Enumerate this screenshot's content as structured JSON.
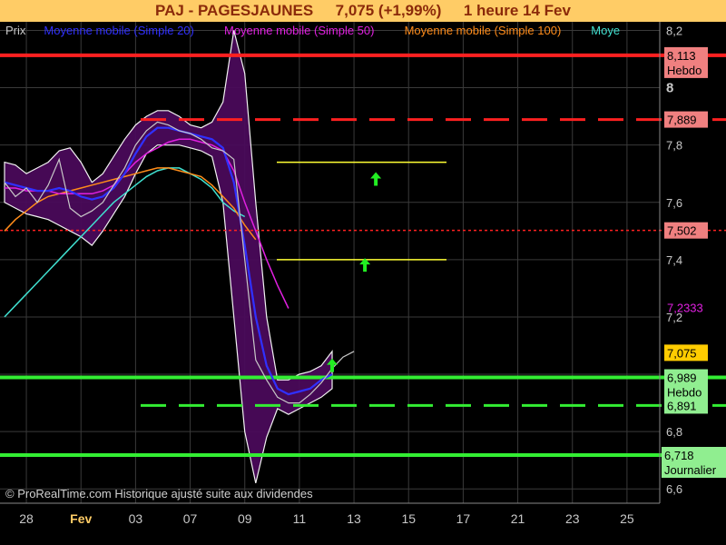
{
  "header": {
    "symbol": "PAJ - PAGESJAUNES",
    "quote": "7,075 (+1,99%)",
    "period": "1 heure  14 Fev"
  },
  "legend": [
    {
      "label": "Prix",
      "color": "#c8c8c8"
    },
    {
      "label": "Moyenne mobile (Simple 20)",
      "color": "#3030ff"
    },
    {
      "label": "Moyenne mobile (Simple 50)",
      "color": "#e020e0"
    },
    {
      "label": "Moyenne mobile (Simple 100)",
      "color": "#ff8c1a"
    },
    {
      "label": "Moye",
      "color": "#40e0d0"
    }
  ],
  "footer": "© ProRealTime.com Historique ajusté suite aux dividendes",
  "chart_data": {
    "type": "line",
    "ylim": [
      6.55,
      8.23
    ],
    "y_ticks": [
      {
        "v": 8.2,
        "label": "8,2"
      },
      {
        "v": 8.0,
        "label": "8"
      },
      {
        "v": 7.8,
        "label": "7,8"
      },
      {
        "v": 7.6,
        "label": "7,6"
      },
      {
        "v": 7.4,
        "label": "7,4"
      },
      {
        "v": 7.2,
        "label": "7,2"
      },
      {
        "v": 7.0,
        "label": "7"
      },
      {
        "v": 6.8,
        "label": "6,8"
      },
      {
        "v": 6.6,
        "label": "6,6"
      }
    ],
    "x_ticks": [
      "28",
      "Fev",
      "03",
      "07",
      "09",
      "11",
      "13",
      "15",
      "17",
      "21",
      "23",
      "25"
    ],
    "x_tick_index": [
      2,
      7,
      12,
      17,
      22,
      27,
      32,
      37,
      42,
      47,
      52,
      57
    ],
    "x_count": 60,
    "series": [
      {
        "name": "Prix",
        "color": "#c8c8c8",
        "values": [
          7.67,
          7.62,
          7.65,
          7.6,
          7.66,
          7.75,
          7.58,
          7.55,
          7.57,
          7.6,
          7.66,
          7.72,
          7.8,
          7.85,
          7.88,
          7.87,
          7.85,
          7.84,
          7.82,
          7.79,
          7.78,
          7.75,
          7.4,
          7.05,
          6.98,
          6.92,
          6.9,
          6.9,
          6.93,
          6.97,
          7.02,
          7.06,
          7.08
        ]
      },
      {
        "name": "Moyenne mobile (Simple 20)",
        "color": "#3030ff",
        "values": [
          7.67,
          7.66,
          7.65,
          7.64,
          7.64,
          7.65,
          7.64,
          7.62,
          7.61,
          7.62,
          7.65,
          7.7,
          7.77,
          7.83,
          7.86,
          7.86,
          7.85,
          7.84,
          7.83,
          7.82,
          7.79,
          7.67,
          7.45,
          7.2,
          7.03,
          6.95,
          6.93,
          6.94,
          6.95,
          6.98,
          7.0
        ]
      },
      {
        "name": "Moyenne mobile (Simple 50)",
        "color": "#e020e0",
        "values": [
          7.65,
          7.65,
          7.64,
          7.64,
          7.64,
          7.63,
          7.63,
          7.63,
          7.63,
          7.64,
          7.66,
          7.7,
          7.74,
          7.77,
          7.79,
          7.81,
          7.82,
          7.82,
          7.81,
          7.8,
          7.78,
          7.71,
          7.6,
          7.5,
          7.4,
          7.31,
          7.23
        ]
      },
      {
        "name": "Moyenne mobile (Simple 100)",
        "color": "#ff8c1a",
        "values": [
          7.5,
          7.54,
          7.57,
          7.6,
          7.62,
          7.63,
          7.64,
          7.65,
          7.66,
          7.67,
          7.68,
          7.69,
          7.7,
          7.71,
          7.72,
          7.72,
          7.71,
          7.7,
          7.69,
          7.66,
          7.62,
          7.58,
          7.52,
          7.47
        ]
      },
      {
        "name": "Moye",
        "color": "#40e0d0",
        "values": [
          7.2,
          7.24,
          7.28,
          7.32,
          7.36,
          7.4,
          7.44,
          7.48,
          7.52,
          7.56,
          7.6,
          7.63,
          7.66,
          7.69,
          7.71,
          7.72,
          7.72,
          7.7,
          7.68,
          7.65,
          7.6,
          7.57,
          7.55
        ]
      }
    ],
    "bollinger_upper": [
      7.74,
      7.73,
      7.7,
      7.72,
      7.74,
      7.78,
      7.79,
      7.74,
      7.67,
      7.7,
      7.76,
      7.82,
      7.87,
      7.9,
      7.92,
      7.92,
      7.9,
      7.87,
      7.86,
      7.88,
      7.95,
      8.2,
      8.05,
      7.6,
      7.2,
      6.98,
      6.98,
      7.0,
      7.01,
      7.03,
      7.08
    ],
    "bollinger_lower": [
      7.6,
      7.58,
      7.56,
      7.55,
      7.54,
      7.52,
      7.5,
      7.48,
      7.45,
      7.5,
      7.56,
      7.62,
      7.7,
      7.77,
      7.8,
      7.8,
      7.8,
      7.79,
      7.78,
      7.76,
      7.6,
      7.2,
      6.8,
      6.62,
      6.78,
      6.88,
      6.86,
      6.88,
      6.9,
      6.92,
      6.95
    ],
    "levels": [
      {
        "value": 8.113,
        "label": "8,113",
        "sublabel": "Hebdo",
        "color": "#ff2020",
        "style": "solid",
        "label_bg": "#f08080"
      },
      {
        "value": 7.889,
        "label": "7,889",
        "sublabel": "",
        "color": "#ff2020",
        "style": "dashed",
        "label_bg": "#f08080"
      },
      {
        "value": 7.502,
        "label": "7,502",
        "sublabel": "",
        "color": "#ff2020",
        "style": "dotted",
        "label_bg": "#f08080"
      },
      {
        "value": 7.2333,
        "label": "7,2333",
        "sublabel": "",
        "color": "#e020e0",
        "style": "none",
        "label_bg": "#000000"
      },
      {
        "value": 7.075,
        "label": "7,075",
        "sublabel": "",
        "color": "#ffcc00",
        "style": "none",
        "label_bg": "#ffcc00"
      },
      {
        "value": 6.989,
        "label": "6,989",
        "sublabel": "Hebdo",
        "color": "#33ee33",
        "style": "solid",
        "label_bg": "#90ee90"
      },
      {
        "value": 6.891,
        "label": "6,891",
        "sublabel": "",
        "color": "#33ee33",
        "style": "dashed",
        "label_bg": "#90ee90"
      },
      {
        "value": 6.718,
        "label": "6,718",
        "sublabel": "Journalier",
        "color": "#33ee33",
        "style": "solid",
        "label_bg": "#90ee90"
      }
    ],
    "yellow_levels": [
      7.74,
      7.4
    ],
    "signal_arrows": [
      {
        "index": 34,
        "value": 7.68
      },
      {
        "index": 33,
        "value": 7.38
      },
      {
        "index": 30,
        "value": 7.03
      }
    ]
  }
}
